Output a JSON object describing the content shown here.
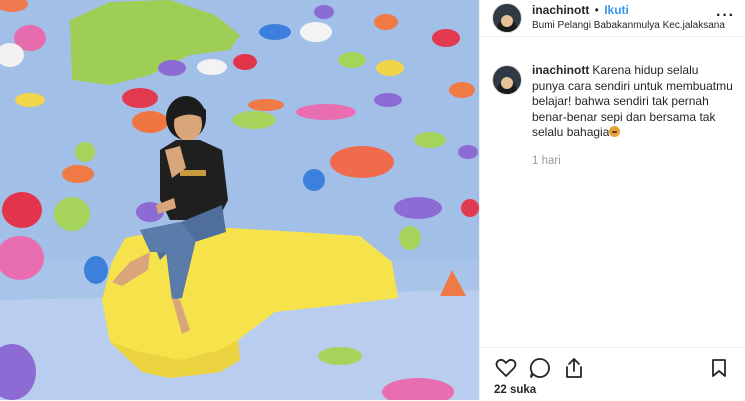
{
  "header": {
    "username": "inachinott",
    "separator": "•",
    "follow_label": "Ikuti",
    "location": "Bumi Pelangi Babakanmulya Kec.jalaksana",
    "more_icon": "more-options-icon"
  },
  "caption": {
    "username": "inachinott",
    "text": "Karena hidup selalu punya cara sendiri untuk membuatmu belajar! bahwa sendiri tak pernah benar-benar sepi dan bersama tak selalu bahagia",
    "emoji": "grimacing-face-emoji",
    "time": "1 hari"
  },
  "actions": {
    "like_icon": "heart-icon",
    "comment_icon": "comment-icon",
    "share_icon": "share-icon",
    "save_icon": "bookmark-icon",
    "likes_text": "22 suka"
  },
  "colors": {
    "wall": "#a8c3e8",
    "follow": "#3897f0",
    "rock_yellow": "#f6e24b"
  }
}
